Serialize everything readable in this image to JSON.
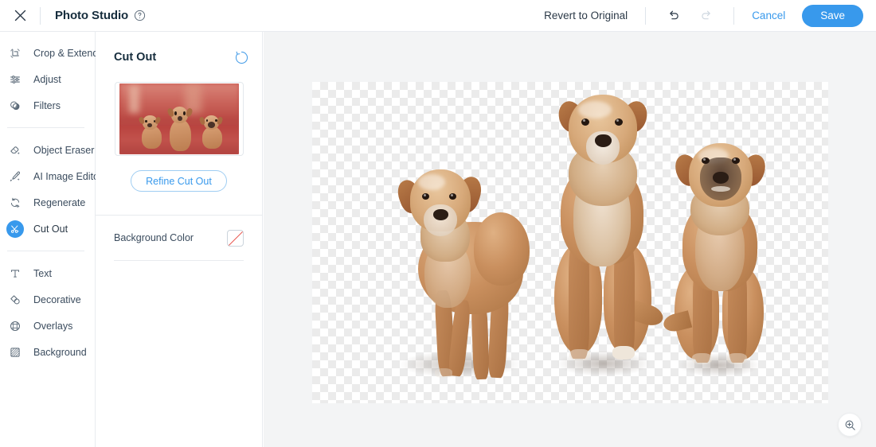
{
  "header": {
    "close_icon": "close-icon",
    "title": "Photo Studio",
    "help_icon": "help-circle-icon",
    "revert_label": "Revert to Original",
    "undo_icon": "undo-icon",
    "redo_icon": "redo-icon",
    "cancel_label": "Cancel",
    "save_label": "Save"
  },
  "sidebar": {
    "groups": [
      {
        "items": [
          {
            "label": "Crop & Extend",
            "icon": "crop-icon",
            "active": false
          },
          {
            "label": "Adjust",
            "icon": "sliders-icon",
            "active": false
          },
          {
            "label": "Filters",
            "icon": "filters-icon",
            "active": false
          }
        ]
      },
      {
        "items": [
          {
            "label": "Object Eraser",
            "icon": "eraser-sparkle-icon",
            "active": false
          },
          {
            "label": "AI Image Editor",
            "icon": "brush-sparkle-icon",
            "active": false
          },
          {
            "label": "Regenerate",
            "icon": "regenerate-icon",
            "active": false
          },
          {
            "label": "Cut Out",
            "icon": "scissors-sparkle-icon",
            "active": true
          }
        ]
      },
      {
        "items": [
          {
            "label": "Text",
            "icon": "text-icon",
            "active": false
          },
          {
            "label": "Decorative",
            "icon": "decorative-icon",
            "active": false
          },
          {
            "label": "Overlays",
            "icon": "overlays-icon",
            "active": false
          },
          {
            "label": "Background",
            "icon": "background-pattern-icon",
            "active": false
          }
        ]
      }
    ]
  },
  "panel": {
    "title": "Cut Out",
    "reset_icon": "reset-circular-arrow-icon",
    "thumbnail_alt": "three dogs on red background",
    "refine_label": "Refine Cut Out",
    "background_color_label": "Background Color",
    "background_color_value": "none",
    "background_color_swatch": "transparent-none-swatch"
  },
  "canvas": {
    "artboard_alt": "three cut-out dogs on transparent checkerboard",
    "zoom_icon": "zoom-in-icon"
  },
  "colors": {
    "accent": "#3899ec",
    "text_dark": "#162d3d",
    "text_muted": "#3b4c5e",
    "border": "#e8ebef",
    "canvas_bg": "#f3f4f5",
    "swatch_slash": "#e8524a"
  }
}
